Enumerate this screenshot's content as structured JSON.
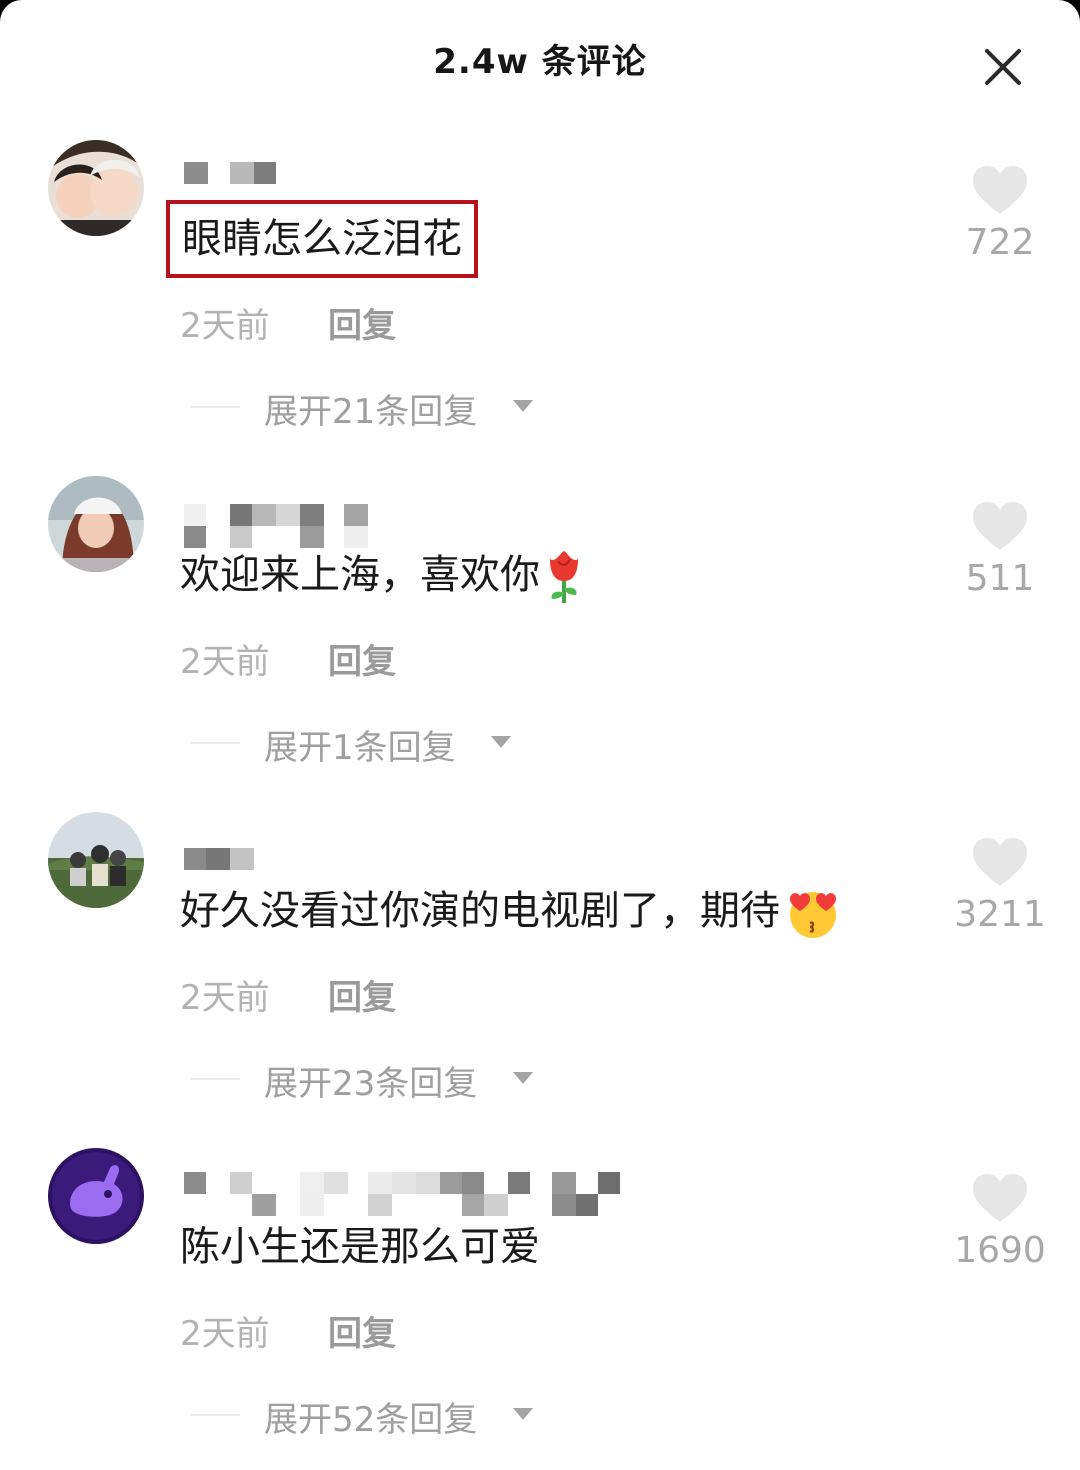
{
  "header": {
    "title": "2.4w 条评论"
  },
  "comments": [
    {
      "text": "眼睛怎么泛泪花",
      "likes": "722",
      "time": "2天前",
      "reply_label": "回复",
      "expand_label": "展开21条回复",
      "emoji": ""
    },
    {
      "text": "欢迎来上海，喜欢你",
      "likes": "511",
      "time": "2天前",
      "reply_label": "回复",
      "expand_label": "展开1条回复",
      "emoji": "rose-emoji"
    },
    {
      "text": "好久没看过你演的电视剧了，期待",
      "likes": "3211",
      "time": "2天前",
      "reply_label": "回复",
      "expand_label": "展开23条回复",
      "emoji": "heart-eyes-kiss-emoji"
    },
    {
      "text": "陈小生还是那么可爱",
      "likes": "1690",
      "time": "2天前",
      "reply_label": "回复",
      "expand_label": "展开52条回复",
      "emoji": ""
    }
  ],
  "colors": {
    "highlight_border": "#b5121b",
    "muted_text": "#a8a8a8",
    "heart": "#e6e6e6"
  },
  "icons": {
    "close": "close-icon",
    "like": "heart-icon",
    "expand": "caret-down-icon"
  }
}
